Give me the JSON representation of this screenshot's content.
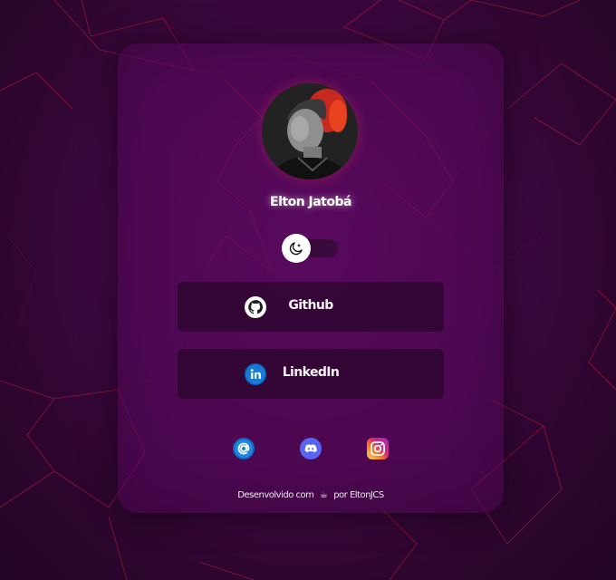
{
  "profile": {
    "name": "Elton Jatobá"
  },
  "theme_toggle": {
    "mode": "dark",
    "icon": "moon-icon"
  },
  "links": [
    {
      "label": "Github",
      "icon": "github-icon"
    },
    {
      "label": "LinkedIn",
      "icon": "linkedin-icon"
    }
  ],
  "social": [
    {
      "icon": "email-icon",
      "color": "#1565c0"
    },
    {
      "icon": "discord-icon",
      "color": "#5865f2"
    },
    {
      "icon": "instagram-icon",
      "color": "#e1306c"
    }
  ],
  "footer": {
    "prefix": "Desenvolvido com",
    "emoji": "☕",
    "suffix": "por EltonJCS"
  },
  "colors": {
    "accent_line": "#e0203c",
    "background": "#440847",
    "card": "#5a0a5f"
  }
}
